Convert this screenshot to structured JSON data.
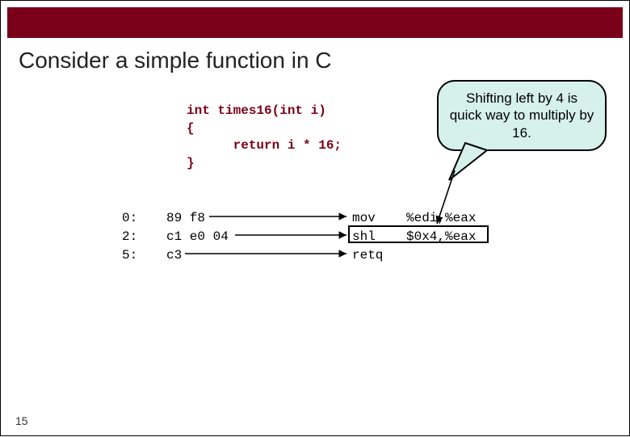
{
  "title": "Consider a simple function in C",
  "code": {
    "l1": "int times16(int i)",
    "l2": "{",
    "l3": "      return i * 16;",
    "l4": "}"
  },
  "asm": {
    "rows": [
      {
        "offset": "0:",
        "bytes": "89 f8",
        "mnemonic": "mov",
        "operands": "%edi,%eax"
      },
      {
        "offset": "2:",
        "bytes": "c1 e0 04",
        "mnemonic": "shl",
        "operands": "$0x4,%eax"
      },
      {
        "offset": "5:",
        "bytes": "c3",
        "mnemonic": "retq",
        "operands": ""
      }
    ]
  },
  "callout_text": "Shifting left by 4 is quick way to multiply by 16.",
  "page_number": "15"
}
